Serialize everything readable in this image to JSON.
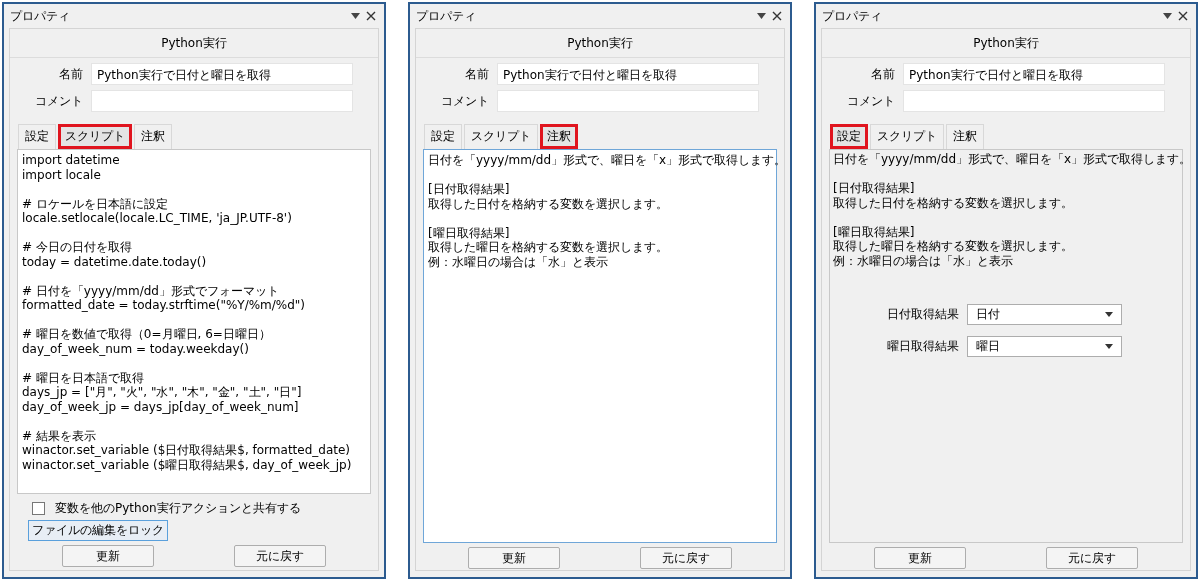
{
  "panels": [
    {
      "title": "プロパティ",
      "header": "Python実行",
      "fields": [
        {
          "label": "名前",
          "value": "Python実行で日付と曜日を取得"
        },
        {
          "label": "コメント"
        }
      ],
      "tabs": [
        {
          "label": "設定",
          "selected": false,
          "highlighted": false
        },
        {
          "label": "スクリプト",
          "selected": true,
          "highlighted": true
        },
        {
          "label": "注釈",
          "selected": false,
          "highlighted": false
        }
      ],
      "content": {
        "kind": "script",
        "blocks": [
          [
            "import datetime",
            "import locale"
          ],
          [
            "# ロケールを日本語に設定",
            "locale.setlocale(locale.LC_TIME, 'ja_JP.UTF-8')"
          ],
          [
            "# 今日の日付を取得",
            "today = datetime.date.today()"
          ],
          [
            "# 日付を「yyyy/mm/dd」形式でフォーマット",
            "formatted_date = today.strftime(\"%Y/%m/%d\")"
          ],
          [
            "# 曜日を数値で取得（0=月曜日, 6=日曜日）",
            "day_of_week_num = today.weekday()"
          ],
          [
            "# 曜日を日本語で取得",
            "days_jp = [\"月\", \"火\", \"水\", \"木\", \"金\", \"土\", \"日\"]",
            "day_of_week_jp = days_jp[day_of_week_num]"
          ],
          [
            "# 結果を表示",
            "winactor.set_variable ($日付取得結果$, formatted_date)",
            "winactor.set_variable ($曜日取得結果$, day_of_week_jp)"
          ]
        ],
        "checkbox": {
          "label": "変数を他のPython実行アクションと共有する",
          "checked": false
        },
        "lock_button": "ファイルの編集をロック"
      },
      "buttons": [
        "更新",
        "元に戻す"
      ]
    },
    {
      "title": "プロパティ",
      "header": "Python実行",
      "fields": [
        {
          "label": "名前",
          "value": "Python実行で日付と曜日を取得"
        },
        {
          "label": "コメント"
        }
      ],
      "tabs": [
        {
          "label": "設定",
          "selected": false,
          "highlighted": false
        },
        {
          "label": "スクリプト",
          "selected": false,
          "highlighted": false
        },
        {
          "label": "注釈",
          "selected": true,
          "highlighted": true
        }
      ],
      "content": {
        "kind": "note",
        "blocks": [
          [
            "日付を「yyyy/mm/dd」形式で、曜日を「x」形式で取得します。"
          ],
          [
            "[日付取得結果]",
            "取得した日付を格納する変数を選択します。"
          ],
          [
            "[曜日取得結果]",
            "取得した曜日を格納する変数を選択します。",
            "例：水曜日の場合は「水」と表示"
          ]
        ]
      },
      "buttons": [
        "更新",
        "元に戻す"
      ]
    },
    {
      "title": "プロパティ",
      "header": "Python実行",
      "fields": [
        {
          "label": "名前",
          "value": "Python実行で日付と曜日を取得"
        },
        {
          "label": "コメント"
        }
      ],
      "tabs": [
        {
          "label": "設定",
          "selected": true,
          "highlighted": true
        },
        {
          "label": "スクリプト",
          "selected": false,
          "highlighted": false
        },
        {
          "label": "注釈",
          "selected": false,
          "highlighted": false
        }
      ],
      "content": {
        "kind": "settings",
        "blocks": [
          [
            "日付を「yyyy/mm/dd」形式で、曜日を「x」形式で取得します。"
          ],
          [
            "[日付取得結果]",
            "取得した日付を格納する変数を選択します。"
          ],
          [
            "[曜日取得結果]",
            "取得した曜日を格納する変数を選択します。",
            "例：水曜日の場合は「水」と表示"
          ]
        ],
        "dropdowns": [
          {
            "label": "日付取得結果",
            "value": "日付"
          },
          {
            "label": "曜日取得結果",
            "value": "曜日"
          }
        ]
      },
      "buttons": [
        "更新",
        "元に戻す"
      ]
    }
  ]
}
